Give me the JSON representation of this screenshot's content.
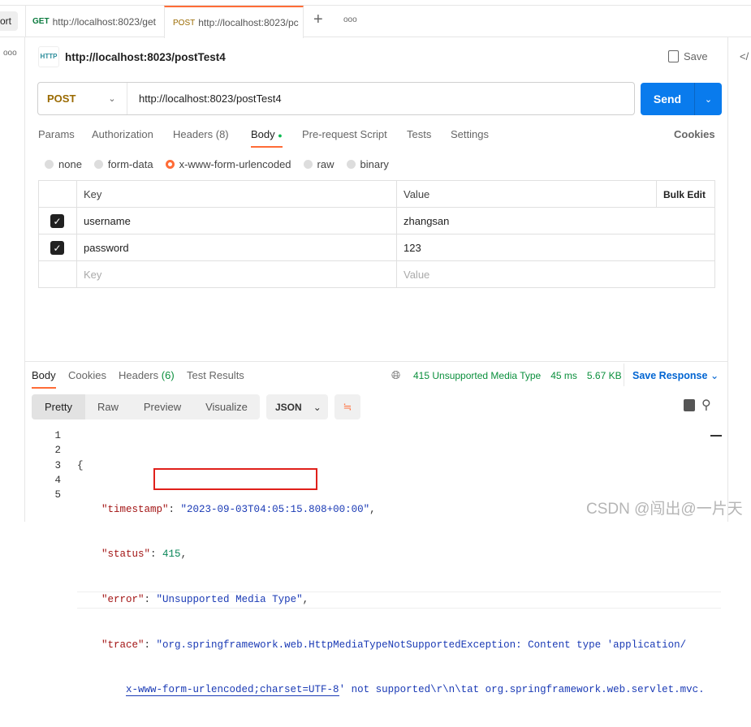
{
  "tabs": {
    "left_partial": "ort",
    "items": [
      {
        "method": "GET",
        "url": "http://localhost:8023/get"
      },
      {
        "method": "POST",
        "url": "http://localhost:8023/pc"
      }
    ],
    "more": "ooo"
  },
  "request": {
    "title": "http://localhost:8023/postTest4",
    "save": "Save",
    "method": "POST",
    "url": "http://localhost:8023/postTest4",
    "send": "Send"
  },
  "req_tabs": {
    "items": [
      "Params",
      "Authorization",
      "Headers (8)",
      "Body",
      "Pre-request Script",
      "Tests",
      "Settings"
    ],
    "active": "Body",
    "cookies": "Cookies"
  },
  "body_types": {
    "items": [
      "none",
      "form-data",
      "x-www-form-urlencoded",
      "raw",
      "binary"
    ],
    "selected": "x-www-form-urlencoded"
  },
  "table": {
    "headers": [
      "Key",
      "Value",
      "Bulk Edit"
    ],
    "rows": [
      {
        "checked": true,
        "key": "username",
        "value": "zhangsan"
      },
      {
        "checked": true,
        "key": "password",
        "value": "123"
      }
    ],
    "placeholder": {
      "key": "Key",
      "value": "Value"
    }
  },
  "response": {
    "tabs": [
      "Body",
      "Cookies",
      "Headers",
      "Test Results"
    ],
    "headers_count": "(6)",
    "status": "415 Unsupported Media Type",
    "time": "45 ms",
    "size": "5.67 KB",
    "save_response": "Save Response",
    "views": [
      "Pretty",
      "Raw",
      "Preview",
      "Visualize"
    ],
    "format": "JSON"
  },
  "code": {
    "line_numbers": [
      "1",
      "2",
      "3",
      "4",
      "5"
    ],
    "l1": "{",
    "timestamp_key": "\"timestamp\"",
    "timestamp_val": "\"2023-09-03T04:05:15.808+00:00\"",
    "status_key": "\"status\"",
    "status_val": "415",
    "error_key": "\"error\"",
    "error_val": "\"Unsupported Media Type\"",
    "trace_key": "\"trace\"",
    "trace_l1": "\"org.springframework.web.HttpMediaTypeNotSupportedException: Content type 'application/",
    "trace_l2a": "x-www-form-urlencoded;charset=UTF-8",
    "trace_l2b": "' not supported\\r\\n\\tat org.springframework.web.servlet.mvc."
  },
  "colors": {
    "accent": "#ff6c37",
    "send": "#097bed",
    "highlight_box": "#e0201b"
  },
  "watermark": "CSDN @闯出@一片天"
}
